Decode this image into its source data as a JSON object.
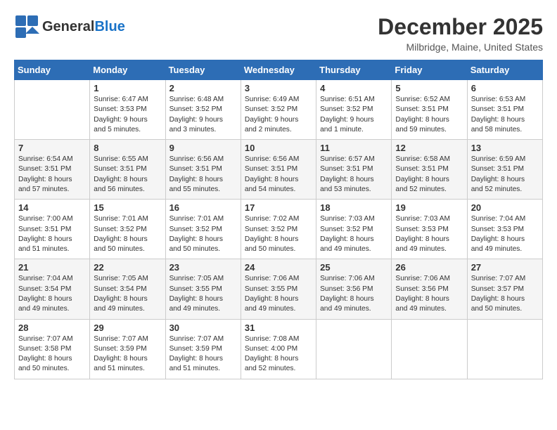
{
  "header": {
    "logo_general": "General",
    "logo_blue": "Blue",
    "month": "December 2025",
    "location": "Milbridge, Maine, United States"
  },
  "days_of_week": [
    "Sunday",
    "Monday",
    "Tuesday",
    "Wednesday",
    "Thursday",
    "Friday",
    "Saturday"
  ],
  "weeks": [
    [
      {
        "day": "",
        "info": ""
      },
      {
        "day": "1",
        "info": "Sunrise: 6:47 AM\nSunset: 3:53 PM\nDaylight: 9 hours\nand 5 minutes."
      },
      {
        "day": "2",
        "info": "Sunrise: 6:48 AM\nSunset: 3:52 PM\nDaylight: 9 hours\nand 3 minutes."
      },
      {
        "day": "3",
        "info": "Sunrise: 6:49 AM\nSunset: 3:52 PM\nDaylight: 9 hours\nand 2 minutes."
      },
      {
        "day": "4",
        "info": "Sunrise: 6:51 AM\nSunset: 3:52 PM\nDaylight: 9 hours\nand 1 minute."
      },
      {
        "day": "5",
        "info": "Sunrise: 6:52 AM\nSunset: 3:51 PM\nDaylight: 8 hours\nand 59 minutes."
      },
      {
        "day": "6",
        "info": "Sunrise: 6:53 AM\nSunset: 3:51 PM\nDaylight: 8 hours\nand 58 minutes."
      }
    ],
    [
      {
        "day": "7",
        "info": "Sunrise: 6:54 AM\nSunset: 3:51 PM\nDaylight: 8 hours\nand 57 minutes."
      },
      {
        "day": "8",
        "info": "Sunrise: 6:55 AM\nSunset: 3:51 PM\nDaylight: 8 hours\nand 56 minutes."
      },
      {
        "day": "9",
        "info": "Sunrise: 6:56 AM\nSunset: 3:51 PM\nDaylight: 8 hours\nand 55 minutes."
      },
      {
        "day": "10",
        "info": "Sunrise: 6:56 AM\nSunset: 3:51 PM\nDaylight: 8 hours\nand 54 minutes."
      },
      {
        "day": "11",
        "info": "Sunrise: 6:57 AM\nSunset: 3:51 PM\nDaylight: 8 hours\nand 53 minutes."
      },
      {
        "day": "12",
        "info": "Sunrise: 6:58 AM\nSunset: 3:51 PM\nDaylight: 8 hours\nand 52 minutes."
      },
      {
        "day": "13",
        "info": "Sunrise: 6:59 AM\nSunset: 3:51 PM\nDaylight: 8 hours\nand 52 minutes."
      }
    ],
    [
      {
        "day": "14",
        "info": "Sunrise: 7:00 AM\nSunset: 3:51 PM\nDaylight: 8 hours\nand 51 minutes."
      },
      {
        "day": "15",
        "info": "Sunrise: 7:01 AM\nSunset: 3:52 PM\nDaylight: 8 hours\nand 50 minutes."
      },
      {
        "day": "16",
        "info": "Sunrise: 7:01 AM\nSunset: 3:52 PM\nDaylight: 8 hours\nand 50 minutes."
      },
      {
        "day": "17",
        "info": "Sunrise: 7:02 AM\nSunset: 3:52 PM\nDaylight: 8 hours\nand 50 minutes."
      },
      {
        "day": "18",
        "info": "Sunrise: 7:03 AM\nSunset: 3:52 PM\nDaylight: 8 hours\nand 49 minutes."
      },
      {
        "day": "19",
        "info": "Sunrise: 7:03 AM\nSunset: 3:53 PM\nDaylight: 8 hours\nand 49 minutes."
      },
      {
        "day": "20",
        "info": "Sunrise: 7:04 AM\nSunset: 3:53 PM\nDaylight: 8 hours\nand 49 minutes."
      }
    ],
    [
      {
        "day": "21",
        "info": "Sunrise: 7:04 AM\nSunset: 3:54 PM\nDaylight: 8 hours\nand 49 minutes."
      },
      {
        "day": "22",
        "info": "Sunrise: 7:05 AM\nSunset: 3:54 PM\nDaylight: 8 hours\nand 49 minutes."
      },
      {
        "day": "23",
        "info": "Sunrise: 7:05 AM\nSunset: 3:55 PM\nDaylight: 8 hours\nand 49 minutes."
      },
      {
        "day": "24",
        "info": "Sunrise: 7:06 AM\nSunset: 3:55 PM\nDaylight: 8 hours\nand 49 minutes."
      },
      {
        "day": "25",
        "info": "Sunrise: 7:06 AM\nSunset: 3:56 PM\nDaylight: 8 hours\nand 49 minutes."
      },
      {
        "day": "26",
        "info": "Sunrise: 7:06 AM\nSunset: 3:56 PM\nDaylight: 8 hours\nand 49 minutes."
      },
      {
        "day": "27",
        "info": "Sunrise: 7:07 AM\nSunset: 3:57 PM\nDaylight: 8 hours\nand 50 minutes."
      }
    ],
    [
      {
        "day": "28",
        "info": "Sunrise: 7:07 AM\nSunset: 3:58 PM\nDaylight: 8 hours\nand 50 minutes."
      },
      {
        "day": "29",
        "info": "Sunrise: 7:07 AM\nSunset: 3:59 PM\nDaylight: 8 hours\nand 51 minutes."
      },
      {
        "day": "30",
        "info": "Sunrise: 7:07 AM\nSunset: 3:59 PM\nDaylight: 8 hours\nand 51 minutes."
      },
      {
        "day": "31",
        "info": "Sunrise: 7:08 AM\nSunset: 4:00 PM\nDaylight: 8 hours\nand 52 minutes."
      },
      {
        "day": "",
        "info": ""
      },
      {
        "day": "",
        "info": ""
      },
      {
        "day": "",
        "info": ""
      }
    ]
  ]
}
